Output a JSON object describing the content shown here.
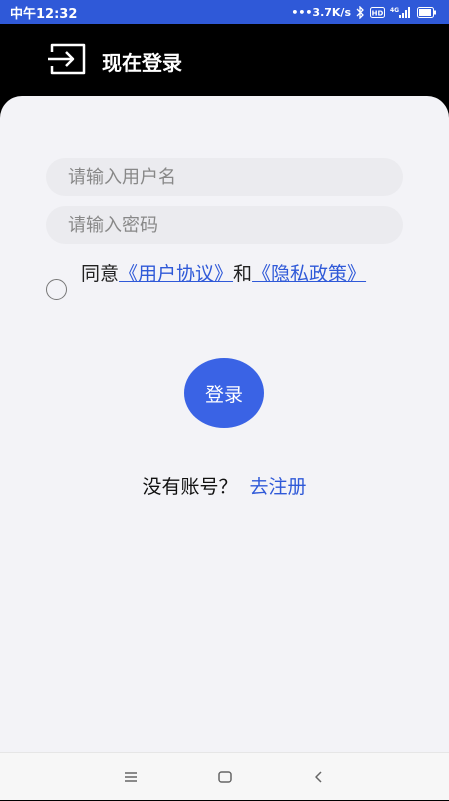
{
  "status_bar": {
    "time": "中午12:32",
    "network_speed": "•••3.7K/s",
    "icons": [
      "bluetooth-icon",
      "hd-icon",
      "signal-4g-icon",
      "battery-icon"
    ]
  },
  "header": {
    "icon": "login-arrow-icon",
    "title": "现在登录"
  },
  "form": {
    "username_placeholder": "请输入用户名",
    "password_placeholder": "请输入密码",
    "agree_prefix": "同意",
    "user_agreement": "《用户协议》",
    "agree_and": "和",
    "privacy_policy": "《隐私政策》",
    "login_label": "登录"
  },
  "register": {
    "prompt": "没有账号？",
    "link": "去注册"
  },
  "nav_bar": {
    "icons": [
      "menu-icon",
      "home-icon",
      "back-icon"
    ]
  },
  "colors": {
    "status_bar": "#2f59d8",
    "accent": "#3a63e5",
    "link": "#2f59d8",
    "panel": "#f3f3f7"
  }
}
